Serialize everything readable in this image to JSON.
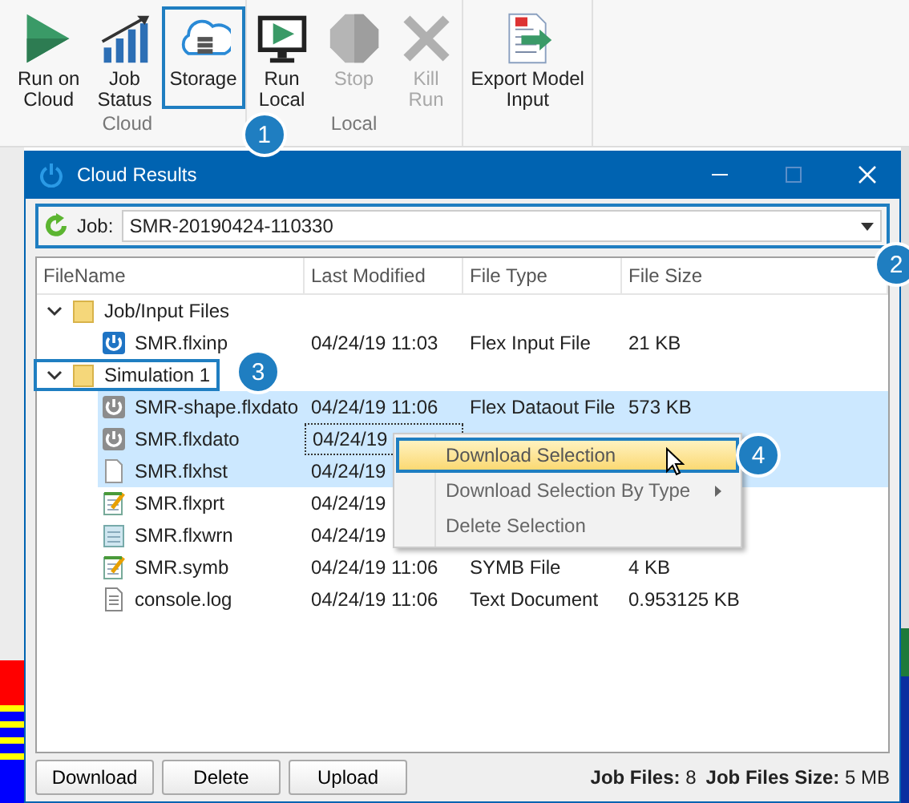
{
  "ribbon": {
    "groups": [
      {
        "label": "Cloud",
        "buttons": [
          {
            "label": "Run on\nCloud",
            "kind": "play",
            "disabled": false,
            "outlined": false
          },
          {
            "label": "Job\nStatus",
            "kind": "chart",
            "disabled": false,
            "outlined": false
          },
          {
            "label": "Storage",
            "kind": "cloud",
            "disabled": false,
            "outlined": true,
            "callout": "1"
          }
        ]
      },
      {
        "label": "Local",
        "buttons": [
          {
            "label": "Run\nLocal",
            "kind": "monitor",
            "disabled": false,
            "outlined": false
          },
          {
            "label": "Stop",
            "kind": "stop",
            "disabled": true,
            "outlined": false
          },
          {
            "label": "Kill\nRun",
            "kind": "cross",
            "disabled": true,
            "outlined": false
          }
        ]
      },
      {
        "buttons": [
          {
            "label": "Export Model\nInput",
            "kind": "export",
            "disabled": false,
            "outlined": false
          }
        ]
      }
    ]
  },
  "window": {
    "title": "Cloud Results"
  },
  "job": {
    "label": "Job:",
    "value": "SMR-20190424-110330",
    "outlined": true,
    "callout": "2"
  },
  "table": {
    "columns": [
      "FileName",
      "Last Modified",
      "File Type",
      "File Size"
    ],
    "tree": [
      {
        "name": "Job/Input Files",
        "expanded": true,
        "outlined": false,
        "children": [
          {
            "name": "SMR.flxinp",
            "kind": "input",
            "modified": "04/24/19 11:03",
            "type": "Flex Input File",
            "size": "21 KB",
            "selected": false
          }
        ]
      },
      {
        "name": "Simulation 1",
        "expanded": true,
        "outlined": true,
        "callout": "3",
        "children": [
          {
            "name": "SMR-shape.flxdato",
            "kind": "dataout",
            "modified": "04/24/19 11:06",
            "type": "Flex Dataout File",
            "size": "573 KB",
            "selected": true
          },
          {
            "name": "SMR.flxdato",
            "kind": "dataout",
            "modified": "04/24/19",
            "selected": true,
            "focused": true
          },
          {
            "name": "SMR.flxhst",
            "kind": "blank",
            "modified": "04/24/19",
            "selected": true
          },
          {
            "name": "SMR.flxprt",
            "kind": "report",
            "modified": "04/24/19",
            "selected": false
          },
          {
            "name": "SMR.flxwrn",
            "kind": "notes",
            "modified": "04/24/19",
            "selected": false
          },
          {
            "name": "SMR.symb",
            "kind": "report",
            "modified": "04/24/19 11:06",
            "type": "SYMB File",
            "size": "4 KB",
            "selected": false
          },
          {
            "name": "console.log",
            "kind": "text",
            "modified": "04/24/19 11:06",
            "type": "Text Document",
            "size": "0.953125 KB",
            "selected": false
          }
        ]
      }
    ]
  },
  "context_menu": {
    "items": [
      {
        "label": "Download Selection",
        "hovered": true,
        "submenu": false,
        "outlined": true,
        "callout": "4"
      },
      {
        "label": "Download Selection By Type",
        "hovered": false,
        "submenu": true,
        "outlined": false
      },
      {
        "label": "Delete Selection",
        "hovered": false,
        "submenu": false,
        "outlined": false
      }
    ]
  },
  "buttons": [
    "Download",
    "Delete",
    "Upload"
  ],
  "status_bar": [
    "**Job Files:** 8",
    "**Job Files Size:** 5 MB"
  ]
}
